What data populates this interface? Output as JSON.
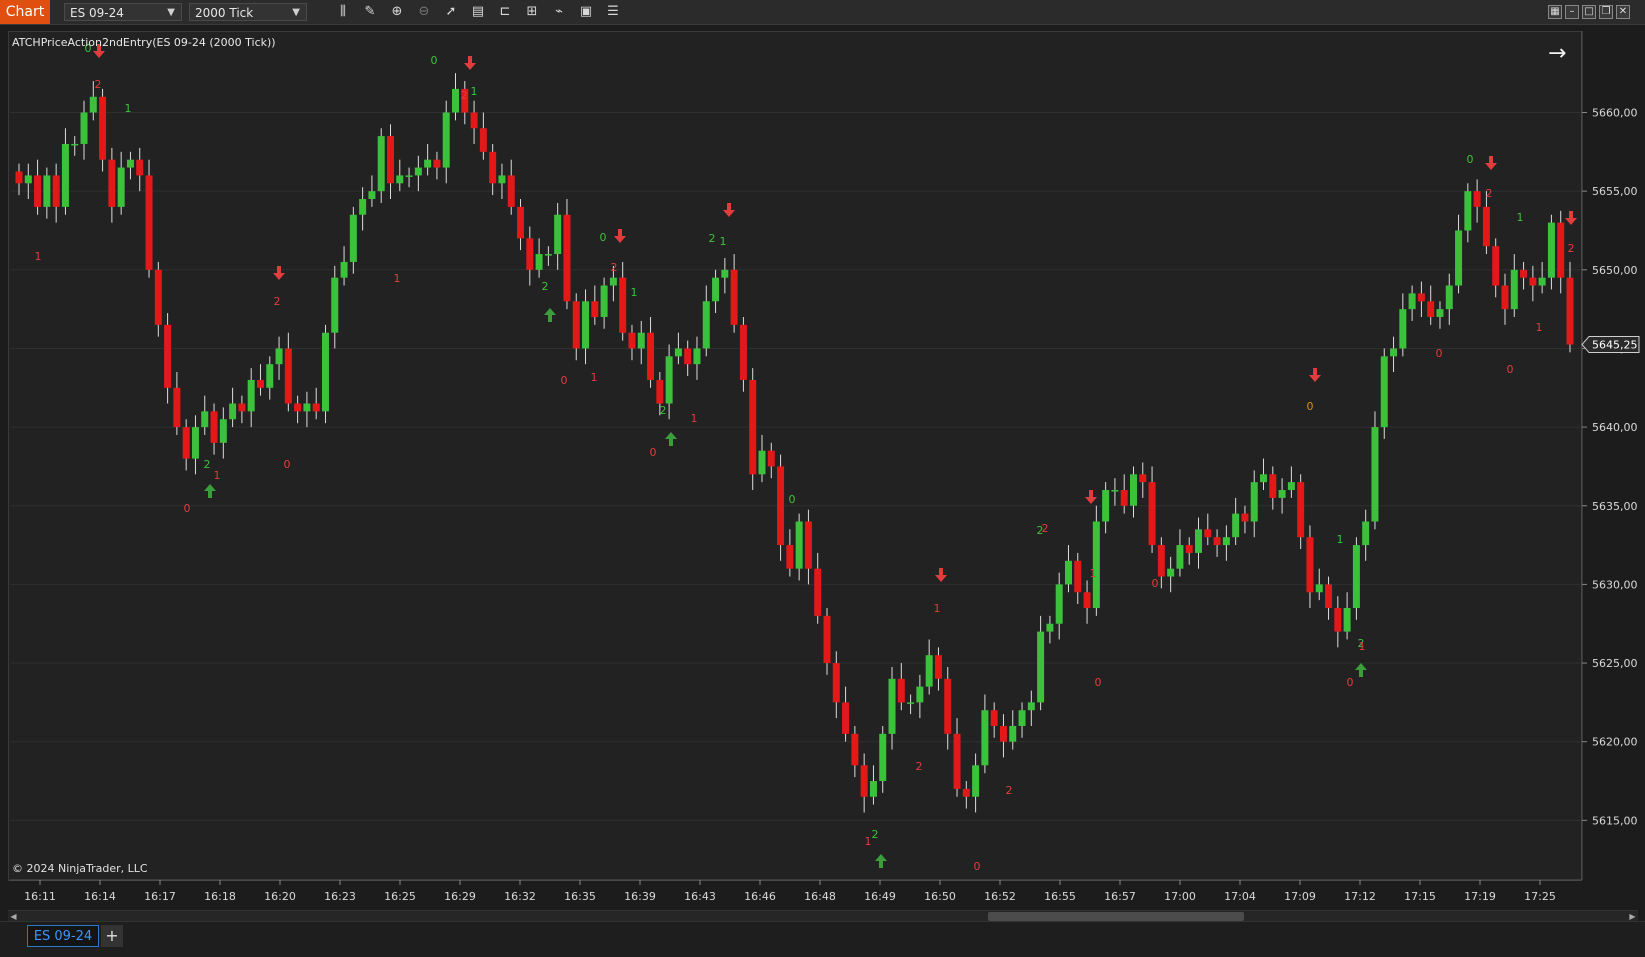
{
  "toolbar": {
    "chart_tab": "Chart",
    "instrument": "ES 09-24",
    "interval": "2000 Tick",
    "tools": [
      "bar-chart-icon",
      "pencil-icon",
      "zoom-in-icon",
      "zoom-out-icon",
      "pointer-icon",
      "data-box-icon",
      "properties-icon",
      "strategies-icon",
      "indicators-icon",
      "template-icon",
      "list-icon"
    ]
  },
  "window_buttons": [
    "tile-icon",
    "minimize-icon",
    "maximize-icon",
    "close-icon"
  ],
  "chart": {
    "indicator_label": "ATCHPriceAction2ndEntry(ES 09-24 (2000 Tick))",
    "copyright": "© 2024 NinjaTrader, LLC",
    "current_price": "5645,25",
    "colors": {
      "background": "#222222",
      "up": "#3cc13c",
      "down": "#e31919",
      "marker_up": "#3a9e3a",
      "marker_down": "#e23c3c",
      "grid": "#2f2f2f"
    }
  },
  "bottom": {
    "tab_label": "ES 09-24",
    "add_label": "+"
  },
  "chart_data": {
    "type": "candlestick",
    "price_axis_labels": [
      "5660,00",
      "5655,00",
      "5650,00",
      "5645,00",
      "5640,00",
      "5635,00",
      "5630,00",
      "5625,00",
      "5620,00",
      "5615,00"
    ],
    "price_axis_values": [
      5660,
      5655,
      5650,
      5645,
      5640,
      5635,
      5630,
      5625,
      5620,
      5615
    ],
    "time_axis_labels": [
      "16:11",
      "16:14",
      "16:17",
      "16:18",
      "16:20",
      "16:23",
      "16:25",
      "16:29",
      "16:32",
      "16:35",
      "16:39",
      "16:43",
      "16:46",
      "16:48",
      "16:49",
      "16:50",
      "16:52",
      "16:55",
      "16:57",
      "17:00",
      "17:04",
      "17:09",
      "17:12",
      "17:15",
      "17:19",
      "17:25"
    ],
    "closes": [
      5655.5,
      5656,
      5654,
      5656,
      5654,
      5658,
      5658,
      5660,
      5661,
      5657,
      5654,
      5656.5,
      5657,
      5656,
      5650,
      5646.5,
      5642.5,
      5640,
      5638,
      5640,
      5641,
      5639,
      5640.5,
      5641.5,
      5641,
      5643,
      5642.5,
      5644,
      5645,
      5641.5,
      5641,
      5641.5,
      5641,
      5646,
      5649.5,
      5650.5,
      5653.5,
      5654.5,
      5655,
      5658.5,
      5655.5,
      5656,
      5656,
      5656.5,
      5657,
      5656.5,
      5660,
      5661.5,
      5660,
      5659,
      5657.5,
      5655.5,
      5656,
      5654,
      5652,
      5650,
      5651,
      5651,
      5653.5,
      5648,
      5645,
      5648,
      5647,
      5649,
      5649.5,
      5646,
      5645,
      5646,
      5643,
      5641.5,
      5644.5,
      5645,
      5644,
      5645,
      5648,
      5649.5,
      5650,
      5646.5,
      5643,
      5637,
      5638.5,
      5637.5,
      5632.5,
      5631,
      5634,
      5631,
      5628,
      5625,
      5622.5,
      5620.5,
      5618.5,
      5616.5,
      5617.5,
      5620.5,
      5624,
      5622.5,
      5622.5,
      5623.5,
      5625.5,
      5624,
      5620.5,
      5617,
      5616.5,
      5618.5,
      5622,
      5621,
      5620,
      5621,
      5622,
      5622.5,
      5627,
      5627.5,
      5630,
      5631.5,
      5629.5,
      5628.5,
      5634,
      5636,
      5636,
      5635,
      5637,
      5636.5,
      5632.5,
      5630.5,
      5631,
      5632.5,
      5632,
      5633.5,
      5633,
      5632.5,
      5633,
      5634.5,
      5634,
      5636.5,
      5637,
      5635.5,
      5636,
      5636.5,
      5633,
      5629.5,
      5630,
      5628.5,
      5627,
      5628.5,
      5632.5,
      5634,
      5640,
      5644.5,
      5645,
      5647.5,
      5648.5,
      5648,
      5647,
      5647.5,
      5649,
      5652.5,
      5655,
      5654,
      5651.5,
      5649,
      5647.5,
      5650,
      5649.5,
      5649,
      5649.5,
      5653,
      5649.5,
      5645.25
    ],
    "signals": [
      {
        "label": "0",
        "color": "green"
      },
      {
        "label": "2",
        "color": "red"
      },
      {
        "label": "1",
        "color": "green"
      },
      {
        "label": "1",
        "color": "red"
      },
      {
        "label": "2",
        "color": "red"
      },
      {
        "label": "2",
        "color": "green"
      },
      {
        "label": "1",
        "color": "red"
      },
      {
        "label": "0",
        "color": "red"
      },
      {
        "label": "0",
        "color": "red"
      },
      {
        "label": "1",
        "color": "red"
      },
      {
        "label": "0",
        "color": "green"
      },
      {
        "label": "2",
        "color": "red"
      },
      {
        "label": "1",
        "color": "green"
      },
      {
        "label": "2",
        "color": "green"
      },
      {
        "label": "0",
        "color": "red"
      },
      {
        "label": "1",
        "color": "red"
      },
      {
        "label": "0",
        "color": "green"
      },
      {
        "label": "2",
        "color": "red"
      },
      {
        "label": "1",
        "color": "green"
      },
      {
        "label": "2",
        "color": "green"
      },
      {
        "label": "0",
        "color": "red"
      },
      {
        "label": "1",
        "color": "red"
      },
      {
        "label": "2",
        "color": "green"
      },
      {
        "label": "1",
        "color": "green"
      },
      {
        "label": "0",
        "color": "green"
      },
      {
        "label": "2",
        "color": "red"
      },
      {
        "label": "2",
        "color": "green"
      },
      {
        "label": "1",
        "color": "red"
      },
      {
        "label": "0",
        "color": "red"
      },
      {
        "label": "0",
        "color": "red"
      },
      {
        "label": "2",
        "color": "green"
      },
      {
        "label": "1",
        "color": "red"
      },
      {
        "label": "2",
        "color": "red"
      },
      {
        "label": "1",
        "color": "red"
      },
      {
        "label": "2",
        "color": "red"
      },
      {
        "label": "0",
        "color": "red"
      },
      {
        "label": "0",
        "color": "red"
      },
      {
        "label": "1",
        "color": "green"
      },
      {
        "label": "2",
        "color": "green"
      },
      {
        "label": "0",
        "color": "red"
      },
      {
        "label": "1",
        "color": "red"
      },
      {
        "label": "0",
        "color": "green"
      },
      {
        "label": "2",
        "color": "red"
      },
      {
        "label": "1",
        "color": "green"
      },
      {
        "label": "0",
        "color": "red"
      },
      {
        "label": "1",
        "color": "red"
      },
      {
        "label": "2",
        "color": "red"
      },
      {
        "label": "0",
        "color": "orange"
      }
    ]
  }
}
